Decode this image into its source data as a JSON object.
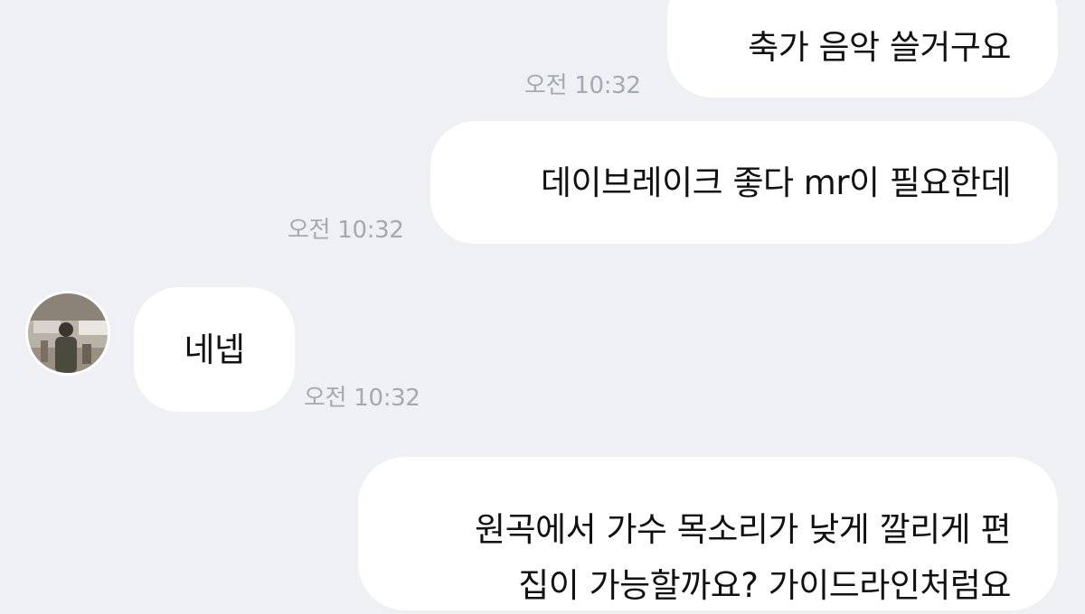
{
  "messages": [
    {
      "sender": "me",
      "text": "축가 음악 쓸거구요",
      "time": "오전 10:32"
    },
    {
      "sender": "me",
      "text": "데이브레이크 좋다 mr이 필요한데",
      "time": "오전 10:32"
    },
    {
      "sender": "other",
      "text": "네넵",
      "time": "오전 10:32",
      "avatar_icon": "profile-photo-avatar"
    },
    {
      "sender": "me",
      "lines": [
        "원곡에서 가수 목소리가 낮게 깔리게 편",
        "집이 가능할까요? 가이드라인처럼요"
      ]
    }
  ],
  "colors": {
    "background": "#eef0f3",
    "bubble": "#ffffff",
    "text": "#111111",
    "timestamp": "#a4a8b0"
  }
}
